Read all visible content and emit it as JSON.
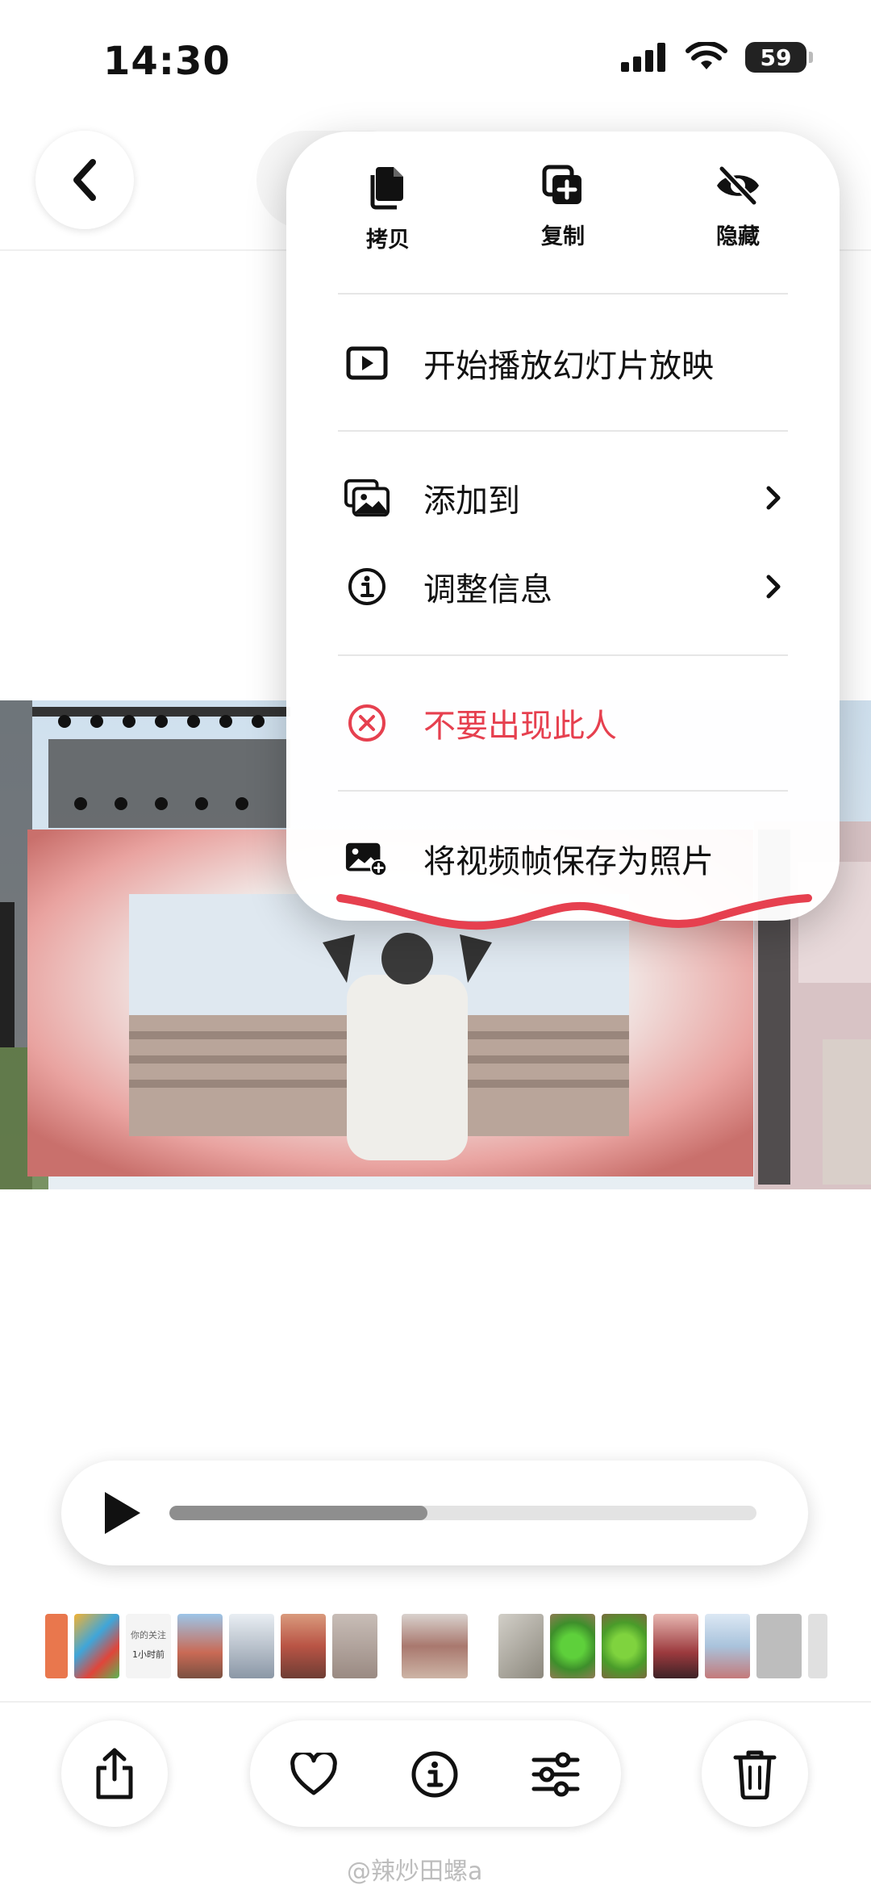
{
  "status_bar": {
    "time": "14:30",
    "battery": "59"
  },
  "menu": {
    "quick_actions": [
      {
        "label": "拷贝",
        "icon": "copy-icon"
      },
      {
        "label": "复制",
        "icon": "duplicate-icon"
      },
      {
        "label": "隐藏",
        "icon": "eye-slash-icon"
      }
    ],
    "items": [
      {
        "label": "开始播放幻灯片放映",
        "icon": "slideshow-icon"
      },
      {
        "label": "添加到",
        "icon": "add-to-album-icon"
      },
      {
        "label": "调整信息",
        "icon": "info-icon"
      },
      {
        "label": "不要出现此人",
        "icon": "remove-person-icon"
      },
      {
        "label": "将视频帧保存为照片",
        "icon": "save-frame-icon"
      }
    ]
  },
  "player": {
    "progress": 0.44
  },
  "thumbnails": [
    {
      "text_line1": "你的关注",
      "text_line2": "1小时前"
    }
  ],
  "toolbar": {
    "icons": [
      "share-icon",
      "heart-icon",
      "info-icon",
      "adjust-icon",
      "trash-icon"
    ]
  },
  "watermark": "@辣炒田螺a",
  "colors": {
    "destructive": "#e6404f",
    "accent_scribble": "#e6404f"
  }
}
